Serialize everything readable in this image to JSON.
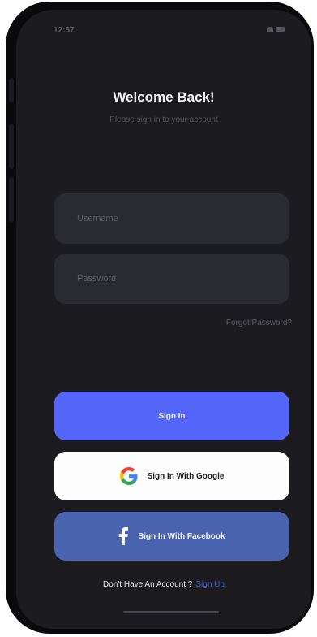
{
  "status_bar": {
    "time": "12:57",
    "wifi_icon": "wifi-icon",
    "battery_icon": "battery-icon"
  },
  "header": {
    "title": "Welcome Back!",
    "subtitle": "Please sign in to your account"
  },
  "form": {
    "username": {
      "placeholder": "Username",
      "value": ""
    },
    "password": {
      "placeholder": "Password",
      "value": ""
    },
    "forgot_label": "Forgot Password?"
  },
  "buttons": {
    "signin_label": "Sign In",
    "google_label": "Sign In With Google",
    "google_icon": "google-icon",
    "facebook_label": "Sign In With Facebook",
    "facebook_icon": "facebook-icon"
  },
  "footer": {
    "prompt": "Don't Have An Account ?",
    "signup_label": "Sign Up"
  },
  "colors": {
    "background": "#1c1c20",
    "field": "#2a2a31",
    "primary": "#5566fa",
    "facebook": "#4a63ae",
    "link": "#4857c9"
  }
}
